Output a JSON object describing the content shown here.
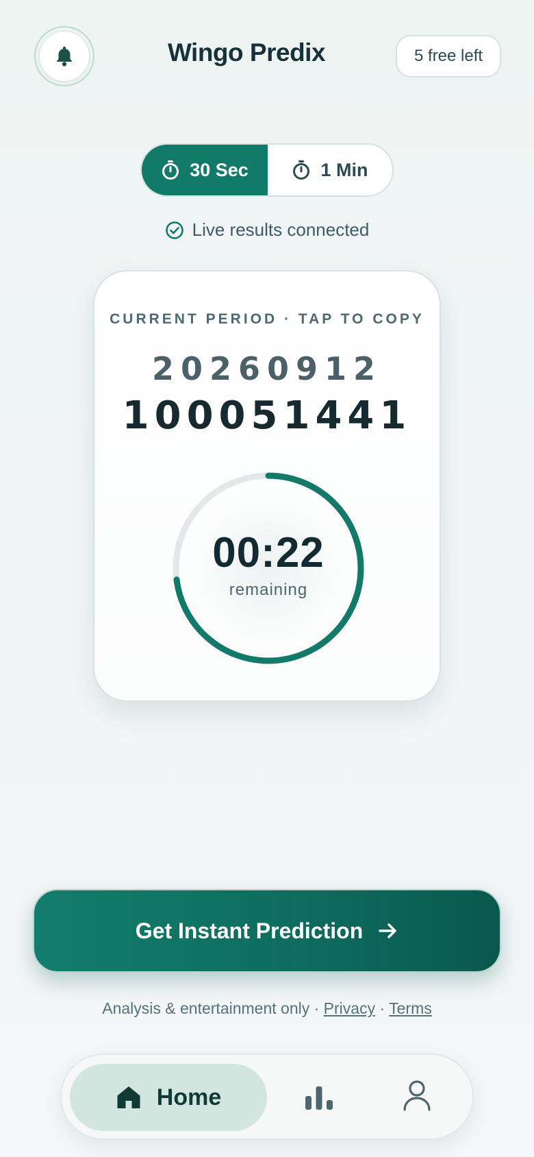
{
  "header": {
    "title": "Wingo Predix",
    "free_badge": "5 free left",
    "bell_icon": "bell-icon"
  },
  "mode_toggle": {
    "options": [
      {
        "label": "30 Sec",
        "icon": "timer-icon",
        "active": true
      },
      {
        "label": "1 Min",
        "icon": "timer-icon",
        "active": false
      }
    ]
  },
  "status": {
    "text": "Live results connected",
    "icon": "check-circle-icon"
  },
  "period_card": {
    "label": "CURRENT PERIOD · TAP TO COPY",
    "period_line1": "20260912",
    "period_line2": "100051441",
    "timer": "00:22",
    "timer_caption": "remaining",
    "progress_fraction": 0.73
  },
  "cta": {
    "label": "Get Instant Prediction",
    "icon": "arrow-right-icon"
  },
  "footer": {
    "note": "Analysis & entertainment only ·",
    "separator": "·",
    "privacy": "Privacy",
    "terms": "Terms"
  },
  "bottom_nav": {
    "home_label": "Home",
    "items": [
      "home-icon",
      "stats-icon",
      "profile-icon"
    ]
  },
  "colors": {
    "accent": "#127a69",
    "accent_dark": "#09584d",
    "text_dark": "#122a30"
  }
}
